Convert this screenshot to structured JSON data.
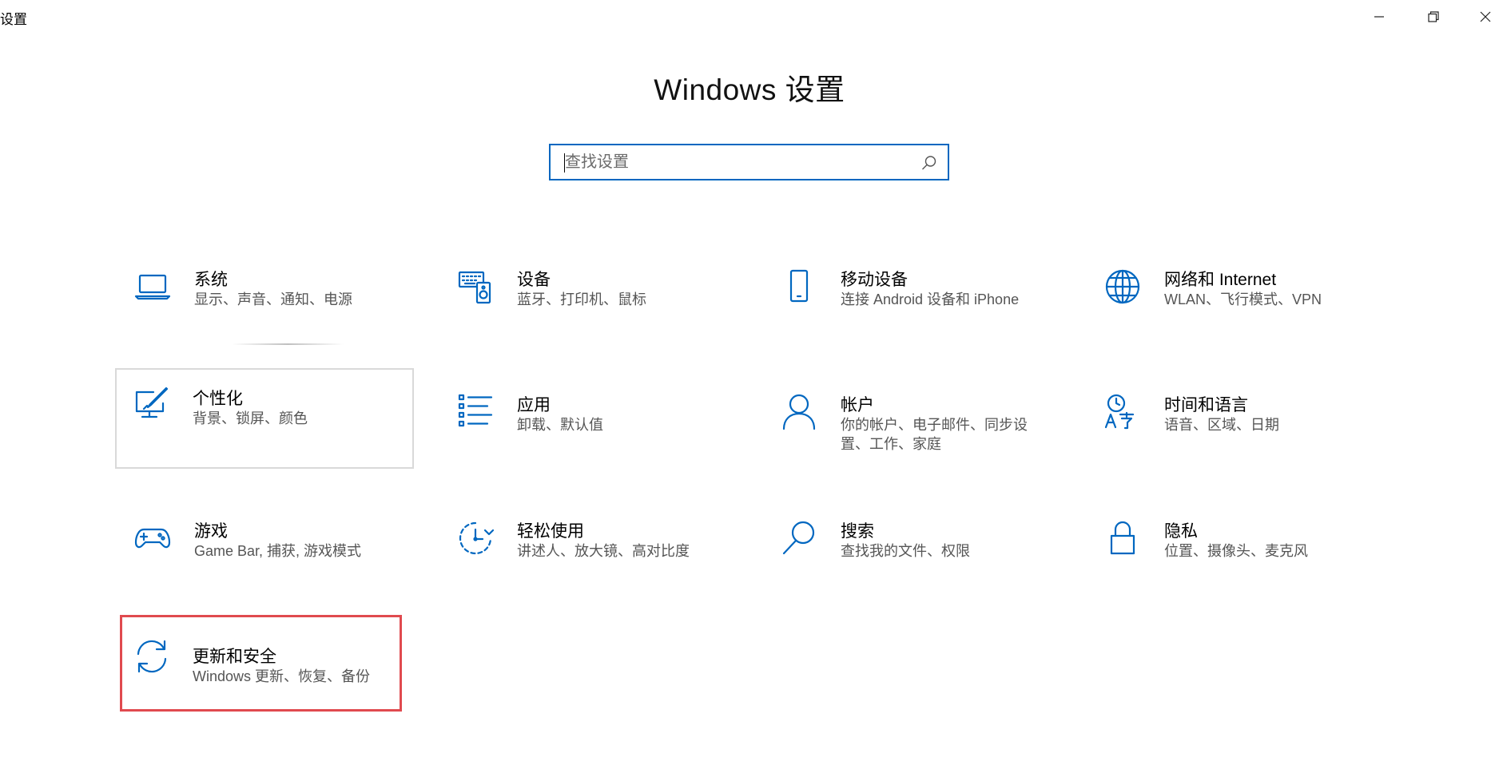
{
  "window": {
    "title": "设置",
    "controls": {
      "minimize": "minimize-icon",
      "restore": "restore-icon",
      "close": "close-icon"
    }
  },
  "header": {
    "title": "Windows 设置"
  },
  "search": {
    "placeholder": "查找设置",
    "value": "",
    "icon": "search-icon"
  },
  "accent_color": "#0067c0",
  "highlight_color": "#e04a4f",
  "tiles": [
    {
      "title": "系统",
      "desc": "显示、声音、通知、电源",
      "icon": "laptop-icon"
    },
    {
      "title": "设备",
      "desc": "蓝牙、打印机、鼠标",
      "icon": "keyboard-speaker-icon"
    },
    {
      "title": "移动设备",
      "desc": "连接 Android 设备和 iPhone",
      "icon": "phone-icon"
    },
    {
      "title": "网络和 Internet",
      "desc": "WLAN、飞行模式、VPN",
      "icon": "globe-icon"
    },
    {
      "title": "个性化",
      "desc": "背景、锁屏、颜色",
      "icon": "paint-brush-icon"
    },
    {
      "title": "应用",
      "desc": "卸载、默认值",
      "icon": "app-list-icon"
    },
    {
      "title": "帐户",
      "desc": "你的帐户、电子邮件、同步设置、工作、家庭",
      "icon": "person-icon"
    },
    {
      "title": "时间和语言",
      "desc": "语音、区域、日期",
      "icon": "time-language-icon"
    },
    {
      "title": "游戏",
      "desc": "Game Bar, 捕获, 游戏模式",
      "icon": "gamepad-icon"
    },
    {
      "title": "轻松使用",
      "desc": "讲述人、放大镜、高对比度",
      "icon": "ease-of-access-icon"
    },
    {
      "title": "搜索",
      "desc": "查找我的文件、权限",
      "icon": "magnifier-icon"
    },
    {
      "title": "隐私",
      "desc": "位置、摄像头、麦克风",
      "icon": "lock-icon"
    },
    {
      "title": "更新和安全",
      "desc": "Windows 更新、恢复、备份",
      "icon": "sync-arrows-icon"
    }
  ]
}
